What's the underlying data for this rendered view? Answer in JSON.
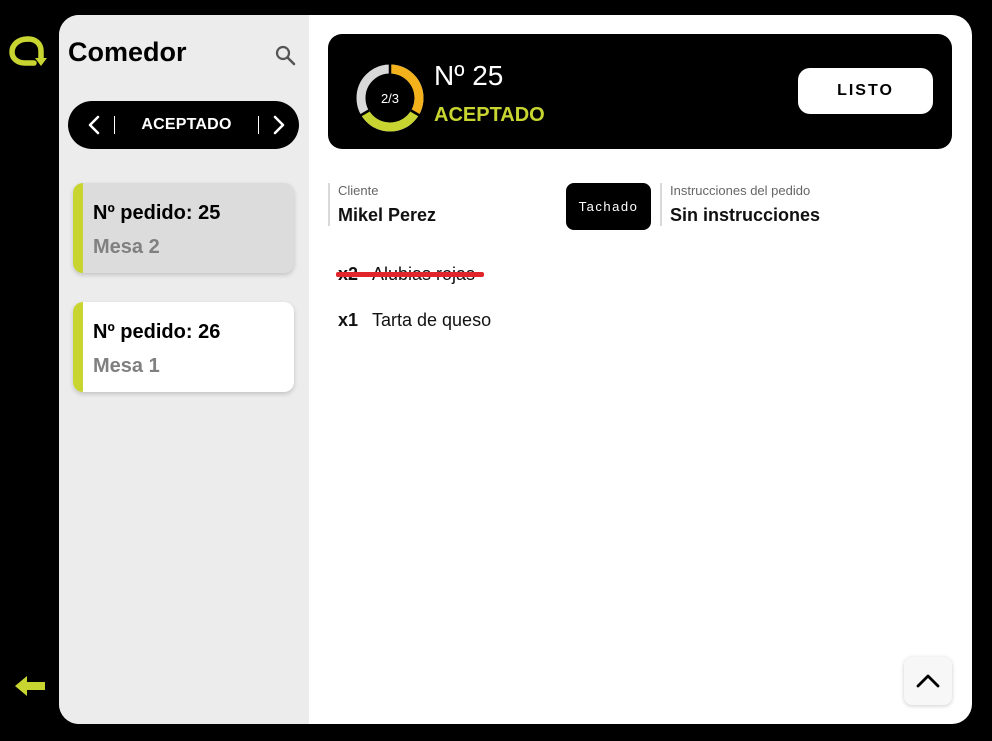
{
  "sidebar": {
    "title": "Comedor",
    "status_filter": "ACEPTADO",
    "orders": [
      {
        "number_label": "Nº pedido: 25",
        "table_label": "Mesa 2"
      },
      {
        "number_label": "Nº pedido: 26",
        "table_label": "Mesa 1"
      }
    ]
  },
  "header": {
    "progress_label": "2/3",
    "progress_fraction": 0.667,
    "order_number": "Nº 25",
    "status": "ACEPTADO",
    "ready_button": "LISTO"
  },
  "details": {
    "client_label": "Cliente",
    "client_name": "Mikel Perez",
    "strike_button": "Tachado",
    "instructions_label": "Instrucciones del pedido",
    "instructions_value": "Sin instrucciones"
  },
  "items": [
    {
      "qty": "x2",
      "name": "Alubias rojas",
      "struck": true
    },
    {
      "qty": "x1",
      "name": "Tarta de queso",
      "struck": false
    }
  ],
  "colors": {
    "accent": "#c8d530",
    "ring_done": "#c8d530",
    "ring_in_progress": "#f3b21b",
    "ring_pending": "#d9d9d9",
    "strike": "#e0262b"
  },
  "icons": {
    "logo": "logo-icon",
    "back": "back-arrow-icon",
    "search": "search-icon",
    "prev": "chevron-left-icon",
    "next": "chevron-right-icon",
    "scroll_top": "chevron-up-icon"
  }
}
